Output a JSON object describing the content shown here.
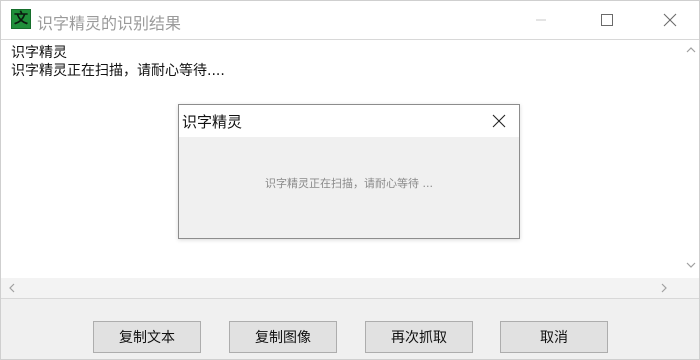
{
  "window": {
    "icon_glyph": "文",
    "title": "识字精灵的识别结果"
  },
  "content": {
    "line1": "识字精灵",
    "line2": "识字精灵正在扫描，请耐心等待...."
  },
  "dialog": {
    "title": "识字精灵",
    "message": "识字精灵正在扫描，请耐心等待 ..."
  },
  "buttons": {
    "copy_text": "复制文本",
    "copy_image": "复制图像",
    "recapture": "再次抓取",
    "cancel": "取消"
  },
  "icons": {
    "app": "app-icon",
    "minimize": "minimize-icon",
    "maximize": "maximize-icon",
    "close": "close-icon",
    "dialog_close": "close-icon",
    "scroll_up": "chevron-up-icon",
    "scroll_down": "chevron-down-icon",
    "scroll_left": "chevron-left-icon",
    "scroll_right": "chevron-right-icon"
  },
  "colors": {
    "app_icon_bg": "#1f8f3a",
    "title_text": "#9a9a9a",
    "dialog_message": "#8a8a8a",
    "button_bg": "#e1e1e1"
  }
}
